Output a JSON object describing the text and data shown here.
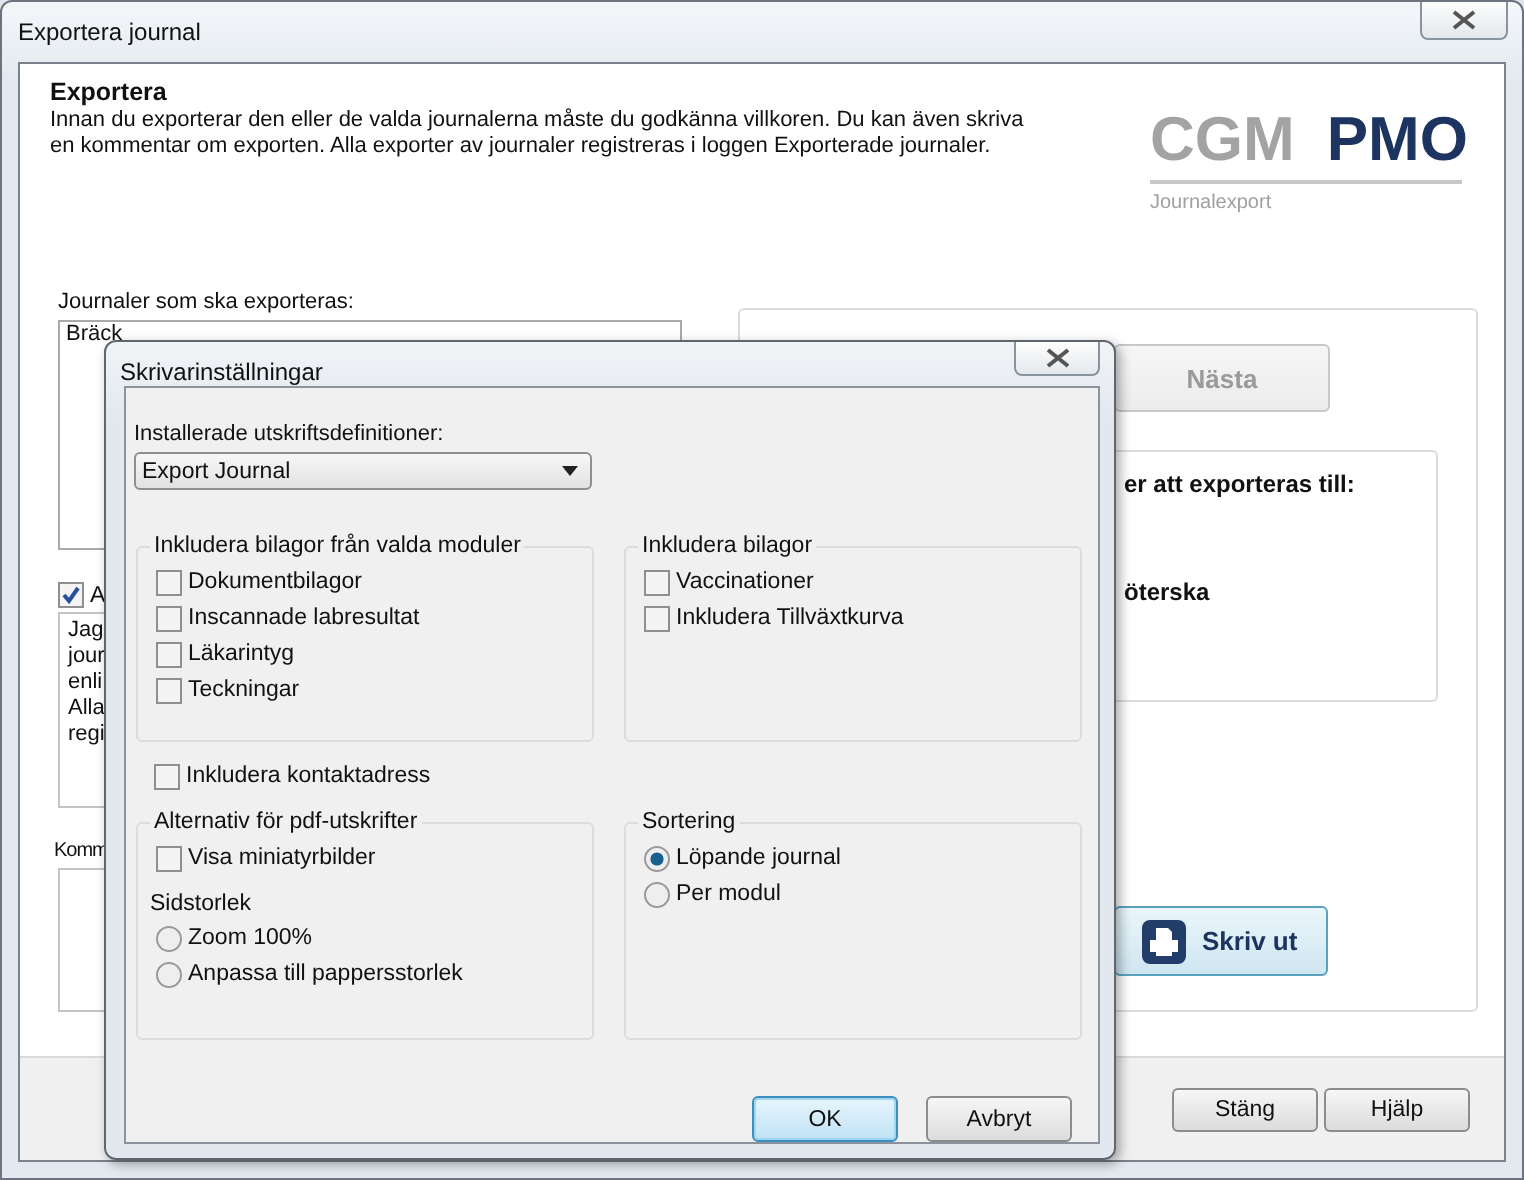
{
  "window": {
    "title": "Exportera journal"
  },
  "header": {
    "title": "Exportera",
    "description": "Innan du exporterar den eller de valda journalerna måste du godkänna villkoren. Du kan även skriva en kommentar om exporten. Alla exporter av journaler registreras i loggen Exporterade journaler."
  },
  "logo": {
    "word_1": "CGM",
    "word_2": "PMO",
    "subtitle": "Journalexport"
  },
  "journals": {
    "label": "Journaler som ska exporteras:",
    "items": [
      "Bräck"
    ]
  },
  "agreement": {
    "checked": true,
    "label": "A",
    "text_lines": [
      "Jag",
      "jour",
      "enli",
      "Alla",
      "regi"
    ]
  },
  "comment": {
    "label": "Komm"
  },
  "next_button": {
    "label": "Nästa",
    "disabled": true
  },
  "destination": {
    "heading": "er att exporteras till:",
    "option": "öterska"
  },
  "print_button": {
    "label": "Skriv ut"
  },
  "footer_buttons": [
    {
      "label": "Stäng"
    },
    {
      "label": "Hjälp"
    }
  ],
  "dialog": {
    "title": "Skrivarinställningar",
    "definitions": {
      "label": "Installerade utskriftsdefinitioner:",
      "value": "Export Journal"
    },
    "module_attachments": {
      "title": "Inkludera bilagor från valda moduler",
      "items": [
        {
          "label": "Dokumentbilagor",
          "checked": false
        },
        {
          "label": "Inscannade labresultat",
          "checked": false
        },
        {
          "label": "Läkarintyg",
          "checked": false
        },
        {
          "label": "Teckningar",
          "checked": false
        }
      ]
    },
    "attachments": {
      "title": "Inkludera bilagor",
      "items": [
        {
          "label": "Vaccinationer",
          "checked": false
        },
        {
          "label": "Inkludera Tillväxtkurva",
          "checked": false
        }
      ]
    },
    "contact_address": {
      "label": "Inkludera kontaktadress",
      "checked": false
    },
    "pdf_options": {
      "title": "Alternativ för pdf-utskrifter",
      "items": [
        {
          "label": "Visa miniatyrbilder",
          "checked": false
        }
      ],
      "page_size": {
        "label": "Sidstorlek",
        "options": [
          {
            "label": "Zoom 100%",
            "selected": false
          },
          {
            "label": "Anpassa till pappersstorlek",
            "selected": false
          }
        ]
      }
    },
    "sorting": {
      "title": "Sortering",
      "options": [
        {
          "label": "Löpande journal",
          "selected": true
        },
        {
          "label": "Per modul",
          "selected": false
        }
      ]
    },
    "buttons": [
      {
        "label": "OK",
        "default": true
      },
      {
        "label": "Avbryt",
        "default": false
      }
    ]
  }
}
